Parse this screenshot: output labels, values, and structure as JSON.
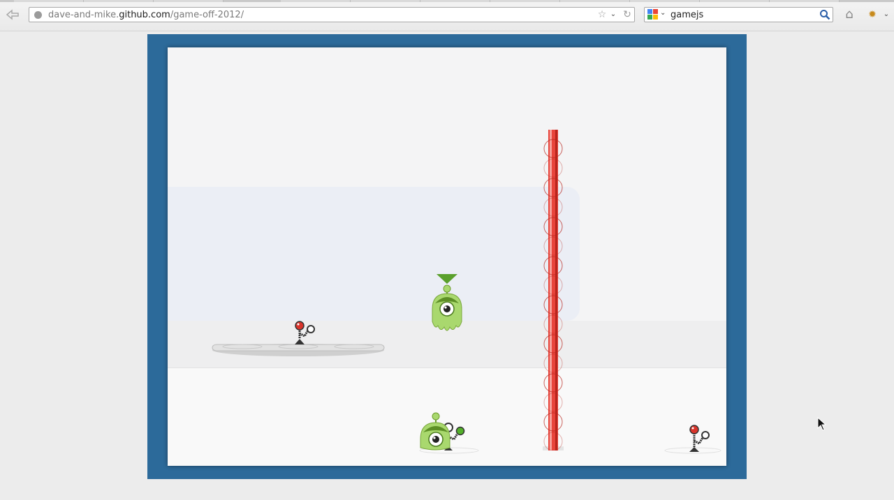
{
  "browser": {
    "back_glyph": "⇦",
    "url": {
      "prefix": "dave-and-mike.",
      "host": "github.com",
      "path": "/game-off-2012/"
    },
    "star_glyph": "☆",
    "dropdown_glyph": "⌄",
    "reload_glyph": "↻",
    "search": {
      "query": "gamejs",
      "engine_icon": "google-icon"
    },
    "home_glyph": "⌂",
    "addon_glyph": "✹",
    "menu_glyph": "⌄"
  },
  "game": {
    "frame_color": "#2c6a9a",
    "laser_color": "#e8453c",
    "alien_color": "#8cc63f",
    "player_marker_color": "#5aa02c",
    "switch_off_color": "#d9342b",
    "switch_on_color": "#53b02a",
    "icons": [
      "alien-player",
      "alien-buddy",
      "lever-switch",
      "laser-beam",
      "hover-platform"
    ]
  }
}
